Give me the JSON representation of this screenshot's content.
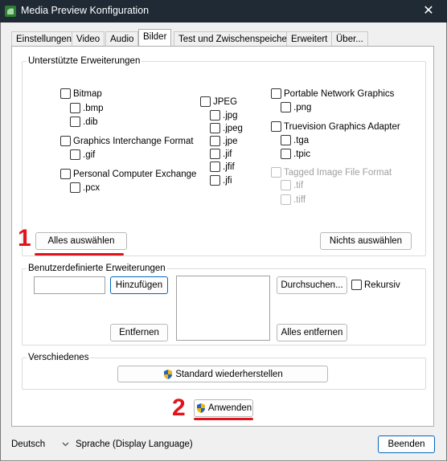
{
  "window": {
    "title": "Media Preview Konfiguration",
    "close_icon": "✕"
  },
  "tabs": [
    {
      "label": "Einstellungen"
    },
    {
      "label": "Video"
    },
    {
      "label": "Audio"
    },
    {
      "label": "Bilder"
    },
    {
      "label": "Test und Zwischenspeicher"
    },
    {
      "label": "Erweitert"
    },
    {
      "label": "Über..."
    }
  ],
  "supported": {
    "group_label": "Unterstützte Erweiterungen",
    "bitmap": {
      "label": "Bitmap",
      "ext": [
        ".bmp",
        ".dib"
      ]
    },
    "gif": {
      "label": "Graphics Interchange Format",
      "ext": [
        ".gif"
      ]
    },
    "pcx": {
      "label": "Personal Computer Exchange",
      "ext": [
        ".pcx"
      ]
    },
    "jpeg": {
      "label": "JPEG",
      "ext": [
        ".jpg",
        ".jpeg",
        ".jpe",
        ".jif",
        ".jfif",
        ".jfi"
      ]
    },
    "png": {
      "label": "Portable Network Graphics",
      "ext": [
        ".png"
      ]
    },
    "tga": {
      "label": "Truevision Graphics Adapter",
      "ext": [
        ".tga",
        ".tpic"
      ]
    },
    "tiff": {
      "label": "Tagged Image File Format",
      "ext": [
        ".tif",
        ".tiff"
      ]
    },
    "select_all": "Alles auswählen",
    "select_none": "Nichts auswählen"
  },
  "custom": {
    "group_label": "Benutzerdefinierte Erweiterungen",
    "input_value": "",
    "add": "Hinzufügen",
    "remove": "Entfernen",
    "browse": "Durchsuchen...",
    "recursive": "Rekursiv",
    "remove_all": "Alles entfernen"
  },
  "misc": {
    "group_label": "Verschiedenes",
    "restore": "Standard wiederherstellen"
  },
  "apply": "Anwenden",
  "footer": {
    "language_value": "Deutsch",
    "language_label": "Sprache (Display Language)",
    "close": "Beenden"
  },
  "annotations": {
    "marker_1": "1",
    "marker_2": "2",
    "color": "#e3131b"
  }
}
